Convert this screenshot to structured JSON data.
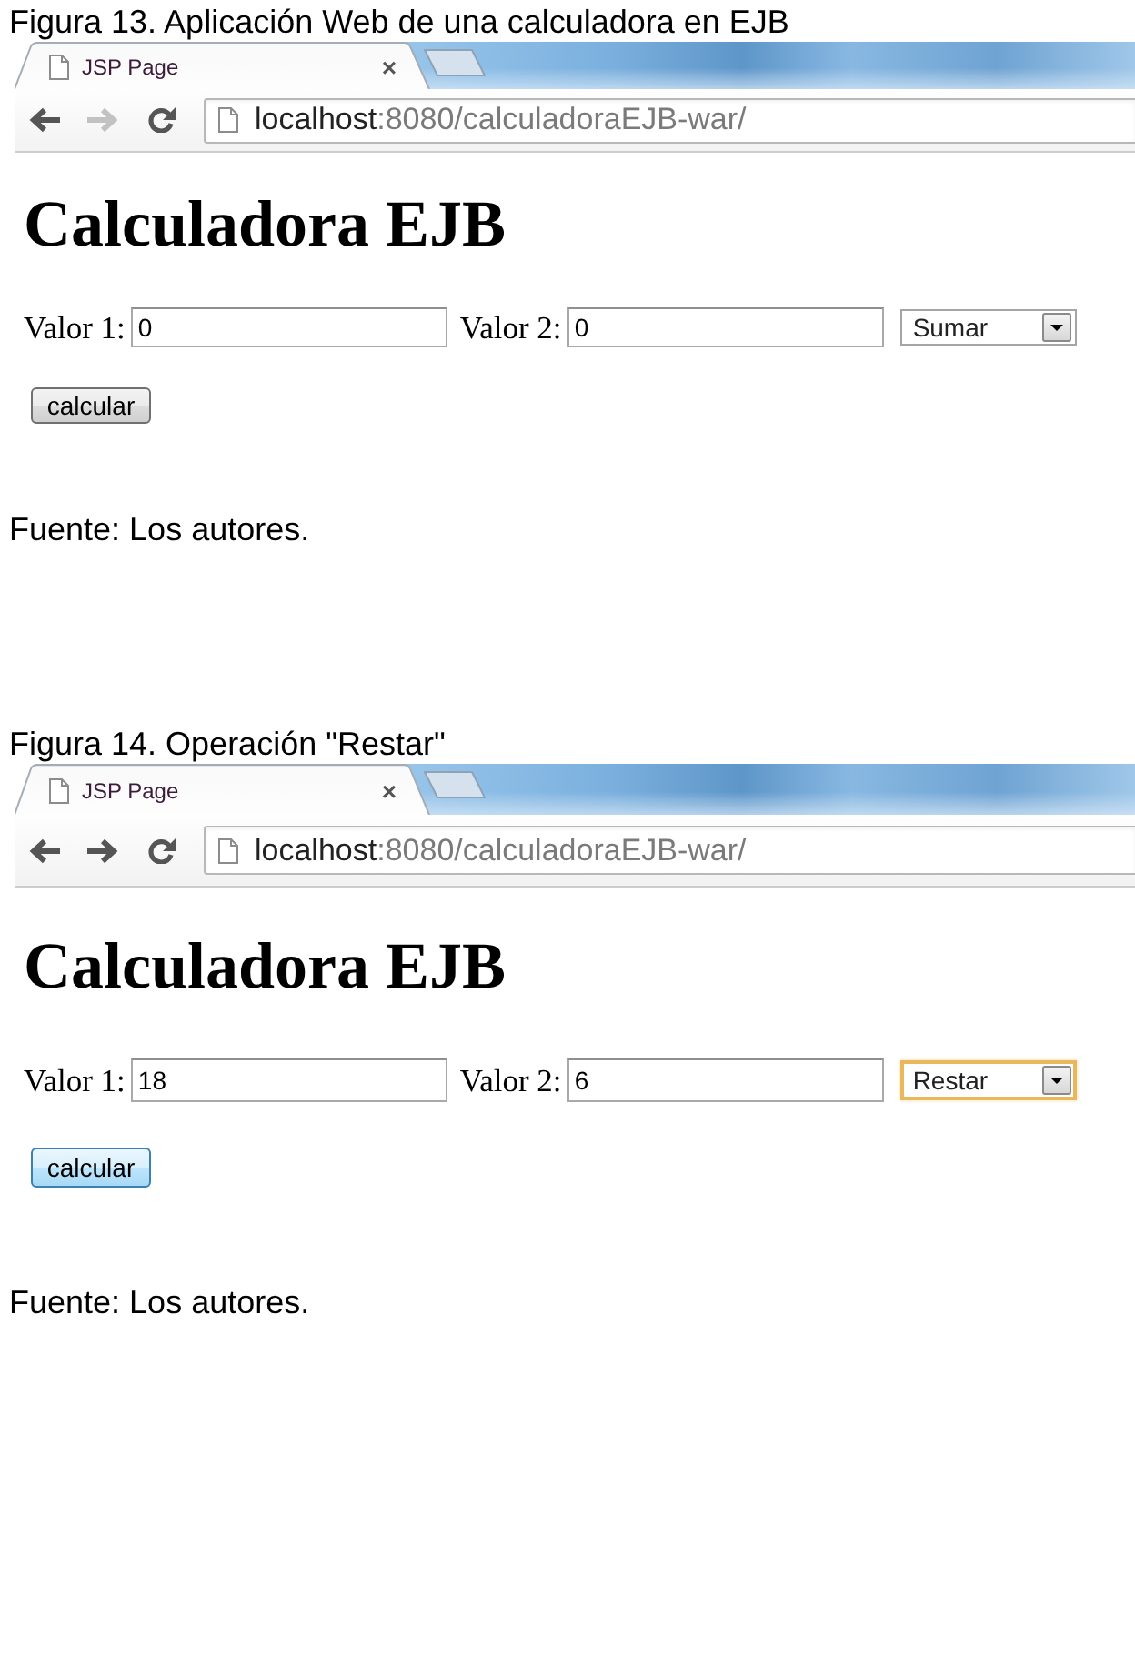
{
  "figures": [
    {
      "caption": "Figura 13. Aplicación Web de una calculadora en EJB",
      "browser": {
        "tab": {
          "title": "JSP Page",
          "close": "×"
        },
        "forward_button": {
          "disabled": true
        },
        "address": {
          "host": "localhost",
          "path": ":8080/calculadoraEJB-war/"
        }
      },
      "page": {
        "heading": "Calculadora EJB",
        "fields": [
          {
            "label": "Valor 1:",
            "value": "0"
          },
          {
            "label": "Valor 2:",
            "value": "0"
          }
        ],
        "operation": {
          "value": "Sumar",
          "focused": false
        },
        "button": {
          "label": "calcular",
          "hovered": false
        }
      },
      "source": "Fuente: Los autores."
    },
    {
      "caption": "Figura 14. Operación \"Restar\"",
      "browser": {
        "tab": {
          "title": "JSP Page",
          "close": "×"
        },
        "forward_button": {
          "disabled": false
        },
        "address": {
          "host": "localhost",
          "path": ":8080/calculadoraEJB-war/"
        }
      },
      "page": {
        "heading": "Calculadora EJB",
        "fields": [
          {
            "label": "Valor 1:",
            "value": "18"
          },
          {
            "label": "Valor 2:",
            "value": "6"
          }
        ],
        "operation": {
          "value": "Restar",
          "focused": true
        },
        "button": {
          "label": "calcular",
          "hovered": true
        }
      },
      "source": "Fuente: Los autores."
    }
  ]
}
